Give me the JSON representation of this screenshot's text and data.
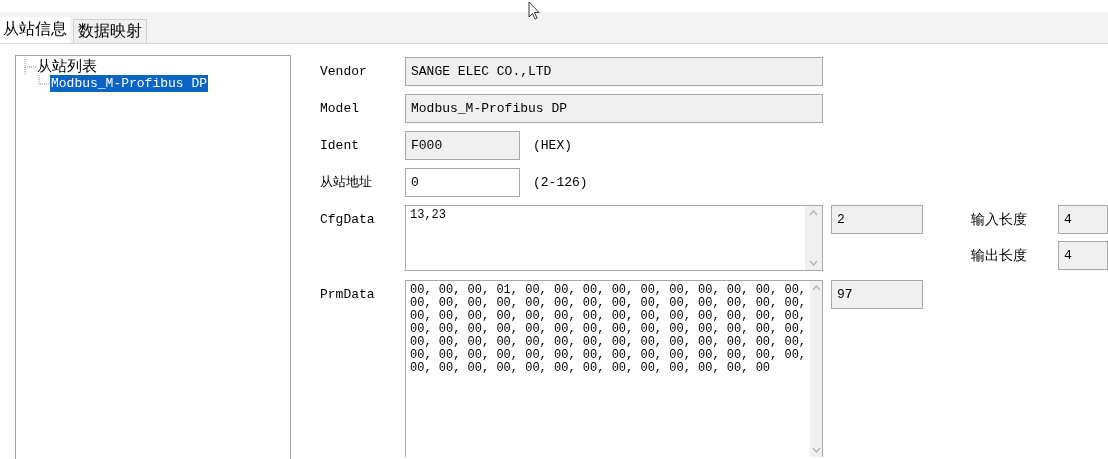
{
  "tabs": [
    {
      "label": "从站信息",
      "selected": true
    },
    {
      "label": "数据映射",
      "selected": false
    }
  ],
  "tree": {
    "items": [
      {
        "label": "从站列表",
        "selected": false,
        "children": [
          {
            "label": "Modbus_M-Profibus DP",
            "selected": true
          }
        ]
      }
    ]
  },
  "vendor": {
    "label": "Vendor",
    "value": "SANGE ELEC CO.,LTD",
    "readonly": true
  },
  "model": {
    "label": "Model",
    "value": "Modbus_M-Profibus DP",
    "readonly": true
  },
  "ident": {
    "label": "Ident",
    "value": "F000",
    "readonly": true,
    "hint": "(HEX)"
  },
  "address": {
    "label": "从站地址",
    "value": "0",
    "readonly": false,
    "hint": "(2-126)"
  },
  "cfg_data": {
    "label": "CfgData",
    "lines": [
      "13,23"
    ],
    "readonly": false,
    "count": "2"
  },
  "input_length": {
    "label": "输入长度",
    "value": "4",
    "readonly": true
  },
  "output_length": {
    "label": "输出长度",
    "value": "4",
    "readonly": true
  },
  "prm_data": {
    "label": "PrmData",
    "lines": [
      "00, 00, 00, 01, 00, 00, 00, 00, 00, 00, 00, 00, 00, 00,",
      "00, 00, 00, 00, 00, 00, 00, 00, 00, 00, 00, 00, 00, 00,",
      "00, 00, 00, 00, 00, 00, 00, 00, 00, 00, 00, 00, 00, 00,",
      "00, 00, 00, 00, 00, 00, 00, 00, 00, 00, 00, 00, 00, 00,",
      "00, 00, 00, 00, 00, 00, 00, 00, 00, 00, 00, 00, 00, 00,",
      "00, 00, 00, 00, 00, 00, 00, 00, 00, 00, 00, 00, 00, 00,",
      "00, 00, 00, 00, 00, 00, 00, 00, 00, 00, 00, 00, 00"
    ],
    "readonly": false,
    "count": "97"
  }
}
